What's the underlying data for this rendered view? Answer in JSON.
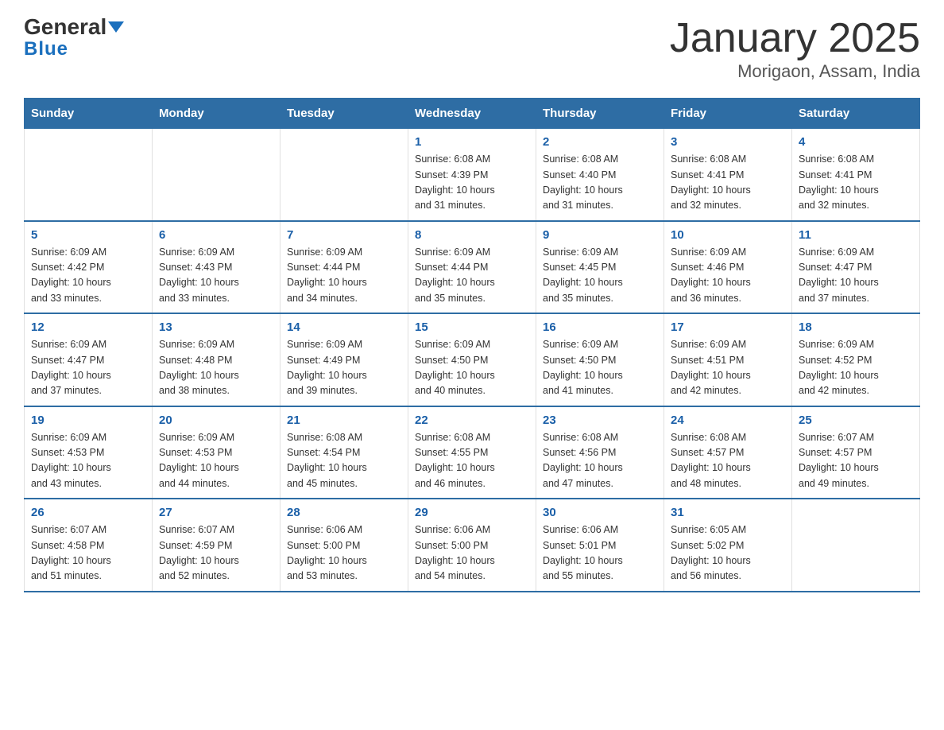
{
  "header": {
    "logo_general": "General",
    "logo_blue": "Blue",
    "title": "January 2025",
    "subtitle": "Morigaon, Assam, India"
  },
  "days_of_week": [
    "Sunday",
    "Monday",
    "Tuesday",
    "Wednesday",
    "Thursday",
    "Friday",
    "Saturday"
  ],
  "weeks": [
    [
      {
        "day": "",
        "info": ""
      },
      {
        "day": "",
        "info": ""
      },
      {
        "day": "",
        "info": ""
      },
      {
        "day": "1",
        "info": "Sunrise: 6:08 AM\nSunset: 4:39 PM\nDaylight: 10 hours\nand 31 minutes."
      },
      {
        "day": "2",
        "info": "Sunrise: 6:08 AM\nSunset: 4:40 PM\nDaylight: 10 hours\nand 31 minutes."
      },
      {
        "day": "3",
        "info": "Sunrise: 6:08 AM\nSunset: 4:41 PM\nDaylight: 10 hours\nand 32 minutes."
      },
      {
        "day": "4",
        "info": "Sunrise: 6:08 AM\nSunset: 4:41 PM\nDaylight: 10 hours\nand 32 minutes."
      }
    ],
    [
      {
        "day": "5",
        "info": "Sunrise: 6:09 AM\nSunset: 4:42 PM\nDaylight: 10 hours\nand 33 minutes."
      },
      {
        "day": "6",
        "info": "Sunrise: 6:09 AM\nSunset: 4:43 PM\nDaylight: 10 hours\nand 33 minutes."
      },
      {
        "day": "7",
        "info": "Sunrise: 6:09 AM\nSunset: 4:44 PM\nDaylight: 10 hours\nand 34 minutes."
      },
      {
        "day": "8",
        "info": "Sunrise: 6:09 AM\nSunset: 4:44 PM\nDaylight: 10 hours\nand 35 minutes."
      },
      {
        "day": "9",
        "info": "Sunrise: 6:09 AM\nSunset: 4:45 PM\nDaylight: 10 hours\nand 35 minutes."
      },
      {
        "day": "10",
        "info": "Sunrise: 6:09 AM\nSunset: 4:46 PM\nDaylight: 10 hours\nand 36 minutes."
      },
      {
        "day": "11",
        "info": "Sunrise: 6:09 AM\nSunset: 4:47 PM\nDaylight: 10 hours\nand 37 minutes."
      }
    ],
    [
      {
        "day": "12",
        "info": "Sunrise: 6:09 AM\nSunset: 4:47 PM\nDaylight: 10 hours\nand 37 minutes."
      },
      {
        "day": "13",
        "info": "Sunrise: 6:09 AM\nSunset: 4:48 PM\nDaylight: 10 hours\nand 38 minutes."
      },
      {
        "day": "14",
        "info": "Sunrise: 6:09 AM\nSunset: 4:49 PM\nDaylight: 10 hours\nand 39 minutes."
      },
      {
        "day": "15",
        "info": "Sunrise: 6:09 AM\nSunset: 4:50 PM\nDaylight: 10 hours\nand 40 minutes."
      },
      {
        "day": "16",
        "info": "Sunrise: 6:09 AM\nSunset: 4:50 PM\nDaylight: 10 hours\nand 41 minutes."
      },
      {
        "day": "17",
        "info": "Sunrise: 6:09 AM\nSunset: 4:51 PM\nDaylight: 10 hours\nand 42 minutes."
      },
      {
        "day": "18",
        "info": "Sunrise: 6:09 AM\nSunset: 4:52 PM\nDaylight: 10 hours\nand 42 minutes."
      }
    ],
    [
      {
        "day": "19",
        "info": "Sunrise: 6:09 AM\nSunset: 4:53 PM\nDaylight: 10 hours\nand 43 minutes."
      },
      {
        "day": "20",
        "info": "Sunrise: 6:09 AM\nSunset: 4:53 PM\nDaylight: 10 hours\nand 44 minutes."
      },
      {
        "day": "21",
        "info": "Sunrise: 6:08 AM\nSunset: 4:54 PM\nDaylight: 10 hours\nand 45 minutes."
      },
      {
        "day": "22",
        "info": "Sunrise: 6:08 AM\nSunset: 4:55 PM\nDaylight: 10 hours\nand 46 minutes."
      },
      {
        "day": "23",
        "info": "Sunrise: 6:08 AM\nSunset: 4:56 PM\nDaylight: 10 hours\nand 47 minutes."
      },
      {
        "day": "24",
        "info": "Sunrise: 6:08 AM\nSunset: 4:57 PM\nDaylight: 10 hours\nand 48 minutes."
      },
      {
        "day": "25",
        "info": "Sunrise: 6:07 AM\nSunset: 4:57 PM\nDaylight: 10 hours\nand 49 minutes."
      }
    ],
    [
      {
        "day": "26",
        "info": "Sunrise: 6:07 AM\nSunset: 4:58 PM\nDaylight: 10 hours\nand 51 minutes."
      },
      {
        "day": "27",
        "info": "Sunrise: 6:07 AM\nSunset: 4:59 PM\nDaylight: 10 hours\nand 52 minutes."
      },
      {
        "day": "28",
        "info": "Sunrise: 6:06 AM\nSunset: 5:00 PM\nDaylight: 10 hours\nand 53 minutes."
      },
      {
        "day": "29",
        "info": "Sunrise: 6:06 AM\nSunset: 5:00 PM\nDaylight: 10 hours\nand 54 minutes."
      },
      {
        "day": "30",
        "info": "Sunrise: 6:06 AM\nSunset: 5:01 PM\nDaylight: 10 hours\nand 55 minutes."
      },
      {
        "day": "31",
        "info": "Sunrise: 6:05 AM\nSunset: 5:02 PM\nDaylight: 10 hours\nand 56 minutes."
      },
      {
        "day": "",
        "info": ""
      }
    ]
  ]
}
